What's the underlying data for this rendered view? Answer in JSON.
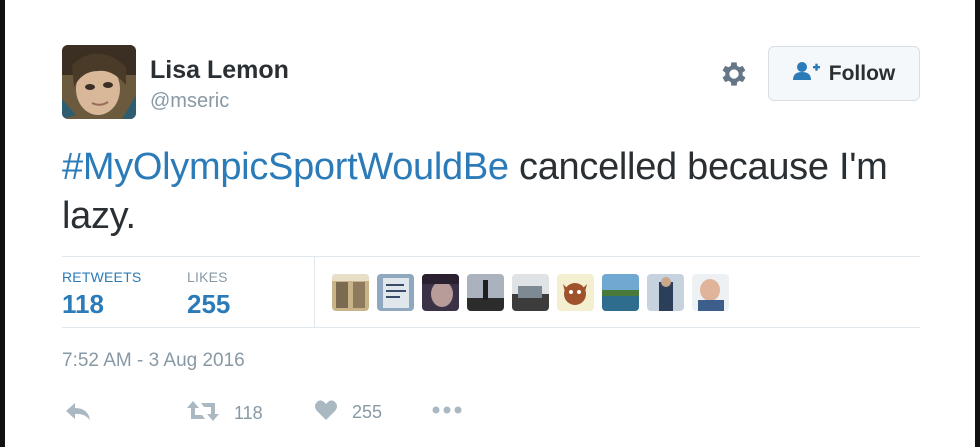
{
  "user": {
    "name": "Lisa Lemon",
    "handle": "@mseric"
  },
  "follow_button": {
    "label": "Follow"
  },
  "tweet": {
    "hashtag": "#MyOlympicSportWouldBe",
    "text": " cancelled because I'm lazy."
  },
  "stats": {
    "retweets_label": "RETWEETS",
    "retweets_count": "118",
    "likes_label": "LIKES",
    "likes_count": "255"
  },
  "timestamp": "7:52 AM - 3 Aug 2016",
  "actions": {
    "retweet_count": "118",
    "like_count": "255"
  },
  "colors": {
    "link_blue": "#2b7bb9",
    "muted_grey": "#8899a6",
    "text_dark": "#292f33"
  },
  "icons": [
    "settings-gear-icon",
    "follow-person-plus-icon",
    "reply-icon",
    "retweet-icon",
    "heart-icon",
    "more-icon"
  ]
}
